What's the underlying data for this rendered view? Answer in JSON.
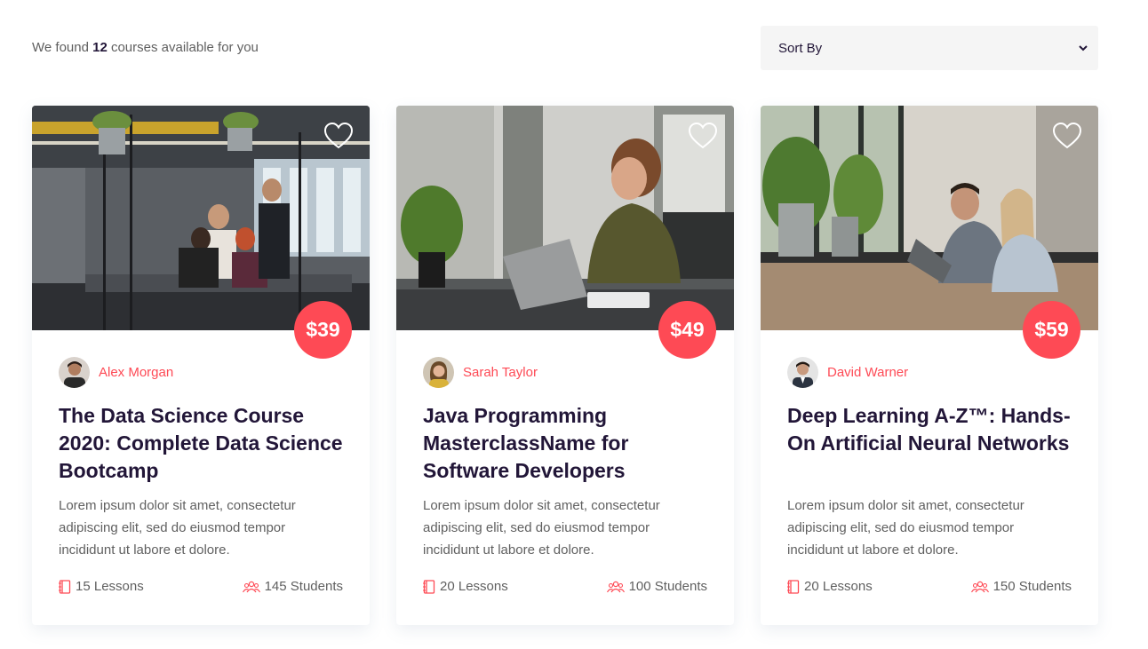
{
  "summary": {
    "prefix": "We found",
    "count": "12",
    "suffix": "courses available for you"
  },
  "sort": {
    "label": "Sort By"
  },
  "colors": {
    "accent": "#fe4a55",
    "heading": "#221638",
    "body_text": "#606060"
  },
  "courses": [
    {
      "price": "$39",
      "author": "Alex Morgan",
      "title": "The Data Science Course 2020: Complete Data Science Bootcamp",
      "description": "Lorem ipsum dolor sit amet, consectetur adipiscing elit, sed do eiusmod tempor incididunt ut labore et dolore.",
      "lessons": "15 Lessons",
      "students": "145 Students",
      "favorite_icon": "heart-icon"
    },
    {
      "price": "$49",
      "author": "Sarah Taylor",
      "title": "Java Programming MasterclassName for Software Developers",
      "description": "Lorem ipsum dolor sit amet, consectetur adipiscing elit, sed do eiusmod tempor incididunt ut labore et dolore.",
      "lessons": "20 Lessons",
      "students": "100 Students",
      "favorite_icon": "heart-icon"
    },
    {
      "price": "$59",
      "author": "David Warner",
      "title": "Deep Learning A-Z™: Hands-On Artificial Neural Networks",
      "description": "Lorem ipsum dolor sit amet, consectetur adipiscing elit, sed do eiusmod tempor incididunt ut labore et dolore.",
      "lessons": "20 Lessons",
      "students": "150 Students",
      "favorite_icon": "heart-icon"
    }
  ]
}
